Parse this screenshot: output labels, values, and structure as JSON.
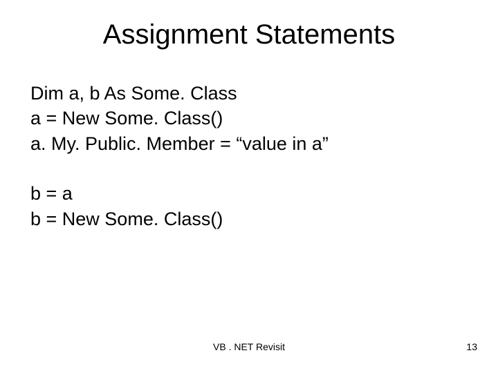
{
  "slide": {
    "title": "Assignment Statements",
    "block1": {
      "line1": "Dim a, b As Some. Class",
      "line2": "a = New Some. Class()",
      "line3": "a. My. Public. Member = “value in a”"
    },
    "block2": {
      "line1": "b = a",
      "line2": "b = New Some. Class()"
    },
    "footer": {
      "center": "VB . NET Revisit",
      "pageNumber": "13"
    }
  }
}
